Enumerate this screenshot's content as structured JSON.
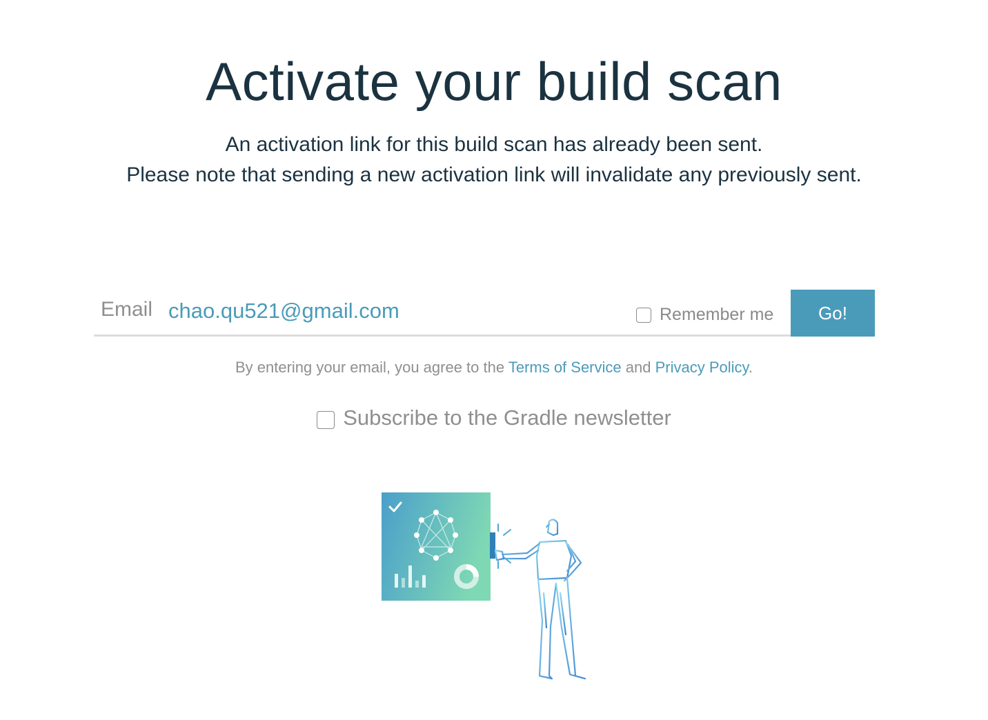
{
  "page": {
    "title": "Activate your build scan",
    "message_line1": "An activation link for this build scan has already been sent.",
    "message_line2": "Please note that sending a new activation link will invalidate any previously sent."
  },
  "form": {
    "email_label": "Email",
    "email_value": "chao.qu521@gmail.com",
    "remember_label": "Remember me",
    "remember_checked": false,
    "submit_label": "Go!"
  },
  "terms": {
    "prefix": "By entering your email, you agree to the ",
    "tos_label": "Terms of Service",
    "middle": " and ",
    "privacy_label": "Privacy Policy",
    "suffix": "."
  },
  "newsletter": {
    "label": "Subscribe to the Gradle newsletter",
    "checked": false
  },
  "illustration": {
    "icon": "build-scan-illustration",
    "colors": {
      "gradient_start": "#4a9fca",
      "gradient_end": "#7fd8b4",
      "line": "#5ab0dc"
    }
  }
}
